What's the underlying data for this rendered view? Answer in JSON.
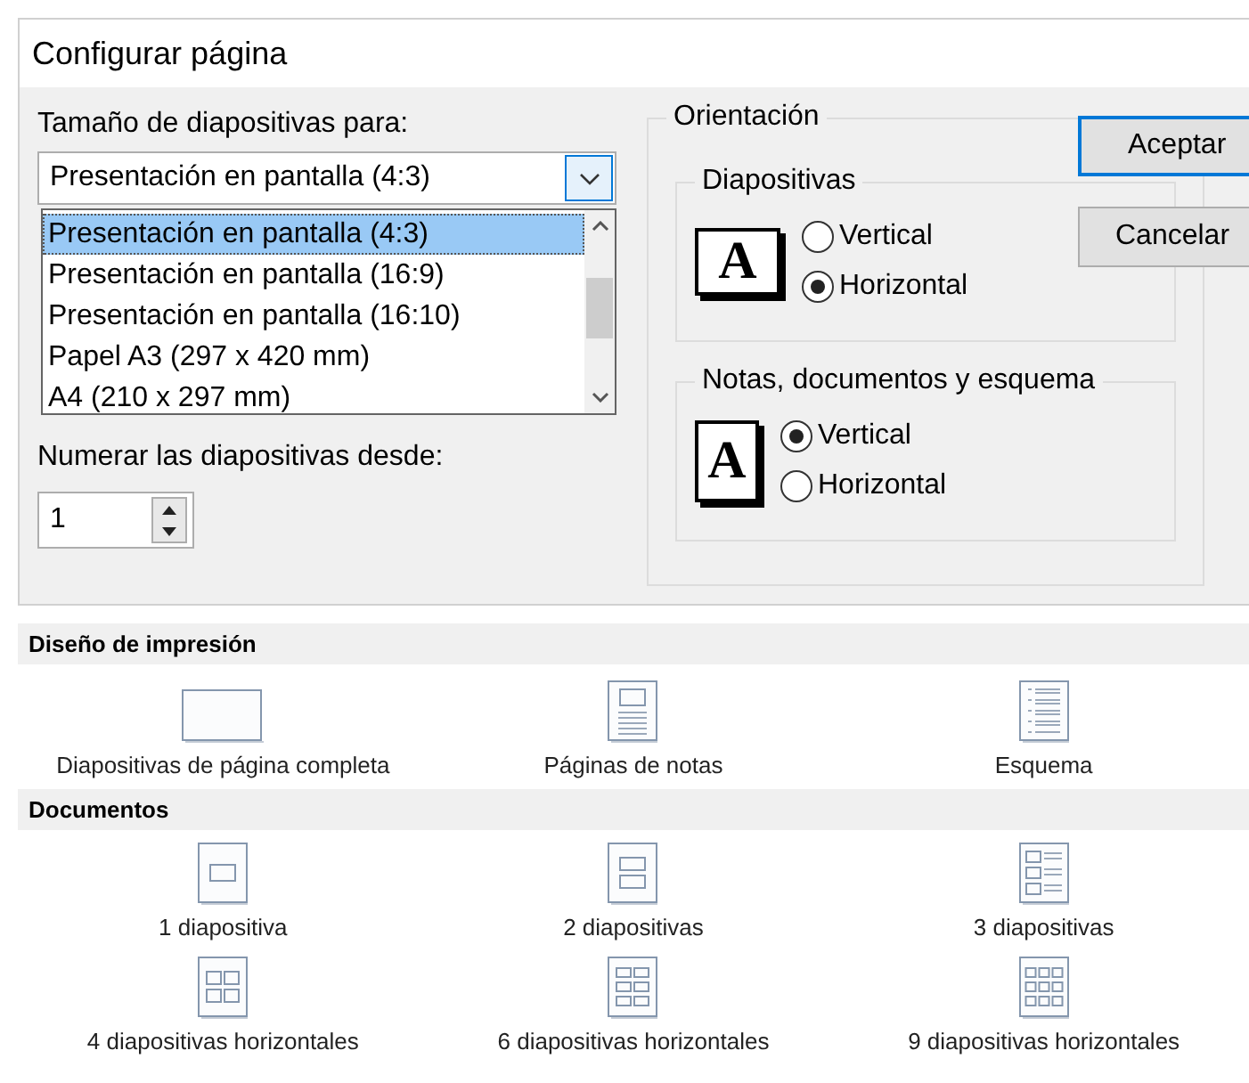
{
  "window": {
    "title": "Configurar página"
  },
  "slide_size": {
    "label": "Tamaño de diapositivas para:",
    "value": "Presentación en pantalla (4:3)",
    "expanded": true,
    "options": [
      {
        "label": "Presentación en pantalla (4:3)",
        "selected": true
      },
      {
        "label": "Presentación en pantalla (16:9)",
        "selected": false
      },
      {
        "label": "Presentación en pantalla (16:10)",
        "selected": false
      },
      {
        "label": "Papel A3 (297 x 420 mm)",
        "selected": false
      },
      {
        "label": "A4 (210 x 297 mm)",
        "selected": false
      }
    ]
  },
  "numbering": {
    "label": "Numerar las diapositivas desde:",
    "value": "1"
  },
  "orientation": {
    "title": "Orientación",
    "groups": [
      {
        "title": "Diapositivas",
        "icon_letter": "A",
        "options": [
          {
            "label": "Vertical",
            "selected": false
          },
          {
            "label": "Horizontal",
            "selected": true
          }
        ]
      },
      {
        "title": "Notas, documentos y esquema",
        "icon_letter": "A",
        "options": [
          {
            "label": "Vertical",
            "selected": true
          },
          {
            "label": "Horizontal",
            "selected": false
          }
        ]
      }
    ]
  },
  "buttons": [
    {
      "label": "Aceptar",
      "default": true
    },
    {
      "label": "Cancelar",
      "default": false
    }
  ],
  "gallery": {
    "sections": [
      {
        "title": "Diseño de impresión",
        "items": [
          {
            "label": "Diapositivas de página completa",
            "kind": "full"
          },
          {
            "label": "Páginas de notas",
            "kind": "notes"
          },
          {
            "label": "Esquema",
            "kind": "outline"
          }
        ]
      },
      {
        "title": "Documentos",
        "items": [
          {
            "label": "1 diapositiva",
            "kind": "h1"
          },
          {
            "label": "2 diapositivas",
            "kind": "h2"
          },
          {
            "label": "3 diapositivas",
            "kind": "h3"
          },
          {
            "label": "4 diapositivas horizontales",
            "kind": "h4"
          },
          {
            "label": "6 diapositivas horizontales",
            "kind": "h6"
          },
          {
            "label": "9 diapositivas horizontales",
            "kind": "h9"
          }
        ]
      }
    ]
  }
}
